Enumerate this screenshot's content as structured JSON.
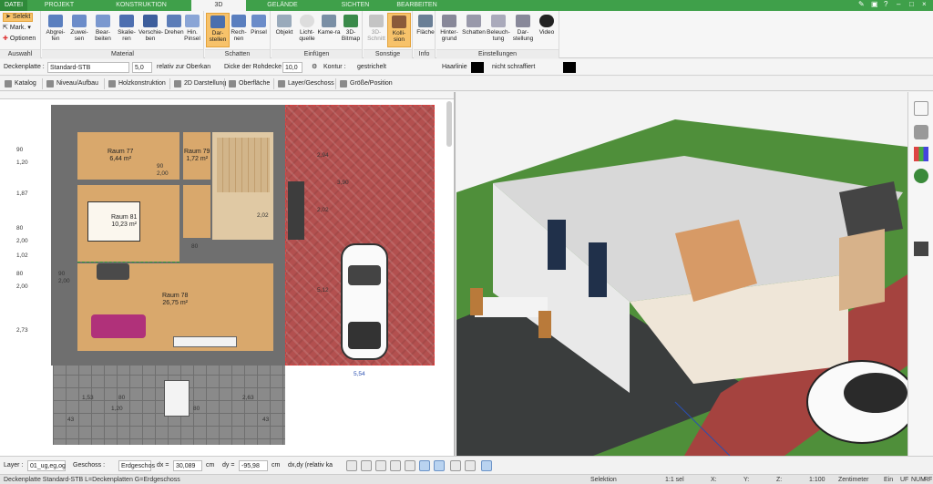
{
  "tabs": [
    "DATEI",
    "PROJEKT",
    "KONSTRUKTION",
    "3D",
    "GELÄNDE",
    "SICHTEN",
    "BEARBEITEN"
  ],
  "ribbon": {
    "auswahl": {
      "label": "Auswahl",
      "selekt": "Selekt",
      "mark": "Mark.",
      "optionen": "Optionen"
    },
    "material": {
      "label": "Material",
      "items": [
        "Abgrei-fen",
        "Zuwei-sen",
        "Bear-beiten",
        "Skalie-ren",
        "Verschie-ben",
        "Drehen",
        "Hin. Pinsel"
      ]
    },
    "schatten": {
      "label": "Schatten",
      "items": [
        "Dar-stellen",
        "Rech-nen",
        "Pinsel"
      ]
    },
    "einfuegen": {
      "label": "Einfügen",
      "items": [
        "Objekt",
        "Licht-quelle",
        "Kame-ra",
        "3D-Bitmap"
      ]
    },
    "sonstige": {
      "label": "Sonstige",
      "items": [
        "3D-Schnitt",
        "Kolli-sion"
      ]
    },
    "info": {
      "label": "Info",
      "items": [
        "Fläche"
      ]
    },
    "einstellungen": {
      "label": "Einstellungen",
      "items": [
        "Hinter-grund",
        "Schatten",
        "Beleuch-tung",
        "Dar-stellung",
        "Video"
      ]
    }
  },
  "propbar": {
    "type": "Deckenplatte :",
    "material": "Standard-STB",
    "value1": "5,0",
    "ref": "relativ zur Oberkan",
    "thickness_label": "Dicke der Rohdecke",
    "thickness": "10,0",
    "kontur_label": "Kontur :",
    "kontur": "gestrichelt",
    "line": "Haarlinie",
    "fill": "nicht schraffiert"
  },
  "subbar": [
    "Katalog",
    "Niveau/Aufbau",
    "Holzkonstruktion",
    "2D Darstellung",
    "Oberfläche",
    "Layer/Geschoss",
    "Größe/Position"
  ],
  "plan": {
    "rooms": [
      {
        "name": "Raum 77",
        "area": "6,44 m²"
      },
      {
        "name": "Raum 79",
        "area": "1,72 m²"
      },
      {
        "name": "Raum 81",
        "area": "10,23 m²"
      },
      {
        "name": "Raum 78",
        "area": "26,75 m²"
      }
    ],
    "dims_left": [
      "90",
      "1,20",
      "1,87",
      "80",
      "2,00",
      "1,02",
      "80",
      "2,00",
      "2,73"
    ],
    "dims_right": [
      "2,94",
      "3,90",
      "2,02",
      "5,12"
    ],
    "dims_bottom": [
      "1,53",
      "80",
      "1,20",
      "80",
      "2,63",
      "43",
      "43",
      "5,54"
    ],
    "door_marks": [
      "90",
      "2,00",
      "2,02",
      "80",
      "90",
      "2,00"
    ]
  },
  "bottombar": {
    "layer_label": "Layer :",
    "layer": "01_ug,eg,og",
    "geschoss_label": "Geschoss :",
    "geschoss": "Erdgeschos",
    "dx_label": "dx =",
    "dx": "30,089",
    "dy_label": "dy =",
    "dy": "-95,98",
    "unit": "cm",
    "mode": "dx,dy (relativ ka"
  },
  "status": {
    "info": "Deckenplatte Standard-STB L=Deckenplatten G=Erdgeschoss",
    "mode": "Selektion",
    "sel": "1:1 sel",
    "x": "X:",
    "y": "Y:",
    "z": "Z:",
    "scale": "1:100",
    "unit": "Zentimeter",
    "ein": "Ein",
    "uf": "UF",
    "num": "NUM",
    "rf": "RF"
  },
  "colors": {
    "accent_green": "#3fa04a",
    "active_orange": "#f7c26a",
    "floor_wood": "#d9a86c",
    "brick_red": "#b3504f"
  }
}
